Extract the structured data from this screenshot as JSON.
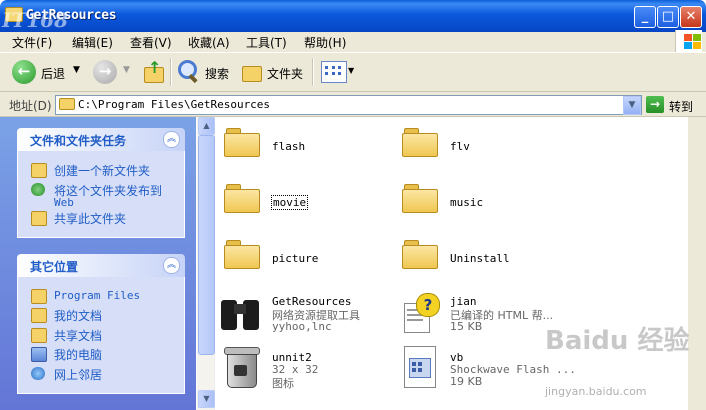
{
  "window": {
    "title": "GetResources"
  },
  "watermark_logo": "IT168",
  "menu": [
    "文件(F)",
    "编辑(E)",
    "查看(V)",
    "收藏(A)",
    "工具(T)",
    "帮助(H)"
  ],
  "toolbar": {
    "back": "后退",
    "search": "搜索",
    "folders": "文件夹"
  },
  "address": {
    "label": "地址(D)",
    "path": "C:\\Program Files\\GetResources",
    "go": "转到"
  },
  "tasks_panel": {
    "title": "文件和文件夹任务",
    "items": [
      "创建一个新文件夹",
      "将这个文件夹发布到",
      "Web",
      "共享此文件夹"
    ]
  },
  "places_panel": {
    "title": "其它位置",
    "items": [
      "Program Files",
      "我的文档",
      "共享文档",
      "我的电脑",
      "网上邻居"
    ]
  },
  "files": {
    "flash": "flash",
    "flv": "flv",
    "movie": "movie",
    "music": "music",
    "picture": "picture",
    "uninstall": "Uninstall",
    "getres": {
      "name": "GetResources",
      "desc": "网络资源提取工具",
      "company": "yyhoo,lnc"
    },
    "jian": {
      "name": "jian",
      "desc": "已编译的 HTML 帮...",
      "size": "15 KB"
    },
    "unnit2": {
      "name": "unnit2",
      "desc": "32 x 32",
      "kind": "图标"
    },
    "vb": {
      "name": "vb",
      "desc": "Shockwave Flash ...",
      "size": "19 KB"
    }
  },
  "watermark": {
    "text": "Baidu 经验",
    "url": "jingyan.baidu.com"
  }
}
